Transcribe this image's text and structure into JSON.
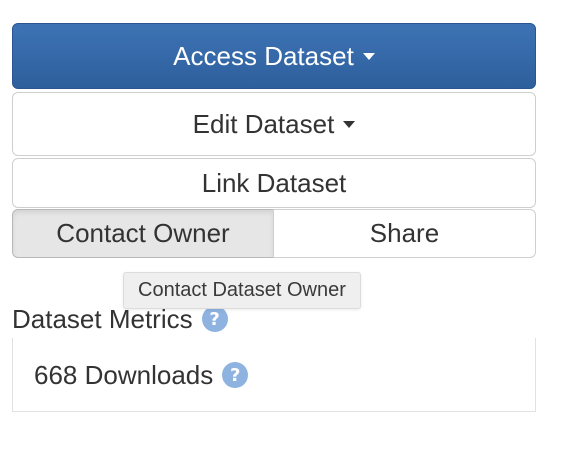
{
  "actions": {
    "access_label": "Access Dataset",
    "edit_label": "Edit Dataset",
    "link_label": "Link Dataset",
    "contact_label": "Contact Owner",
    "share_label": "Share"
  },
  "tooltip": {
    "text": "Contact Dataset Owner"
  },
  "metrics": {
    "heading": "Dataset Metrics",
    "downloads": "668 Downloads",
    "help_glyph": "?"
  },
  "colors": {
    "primary": "#3367a8",
    "help_icon": "#8fb3e0"
  },
  "icons": {
    "dropdown": "caret-down-icon",
    "help": "question-circle-icon"
  }
}
